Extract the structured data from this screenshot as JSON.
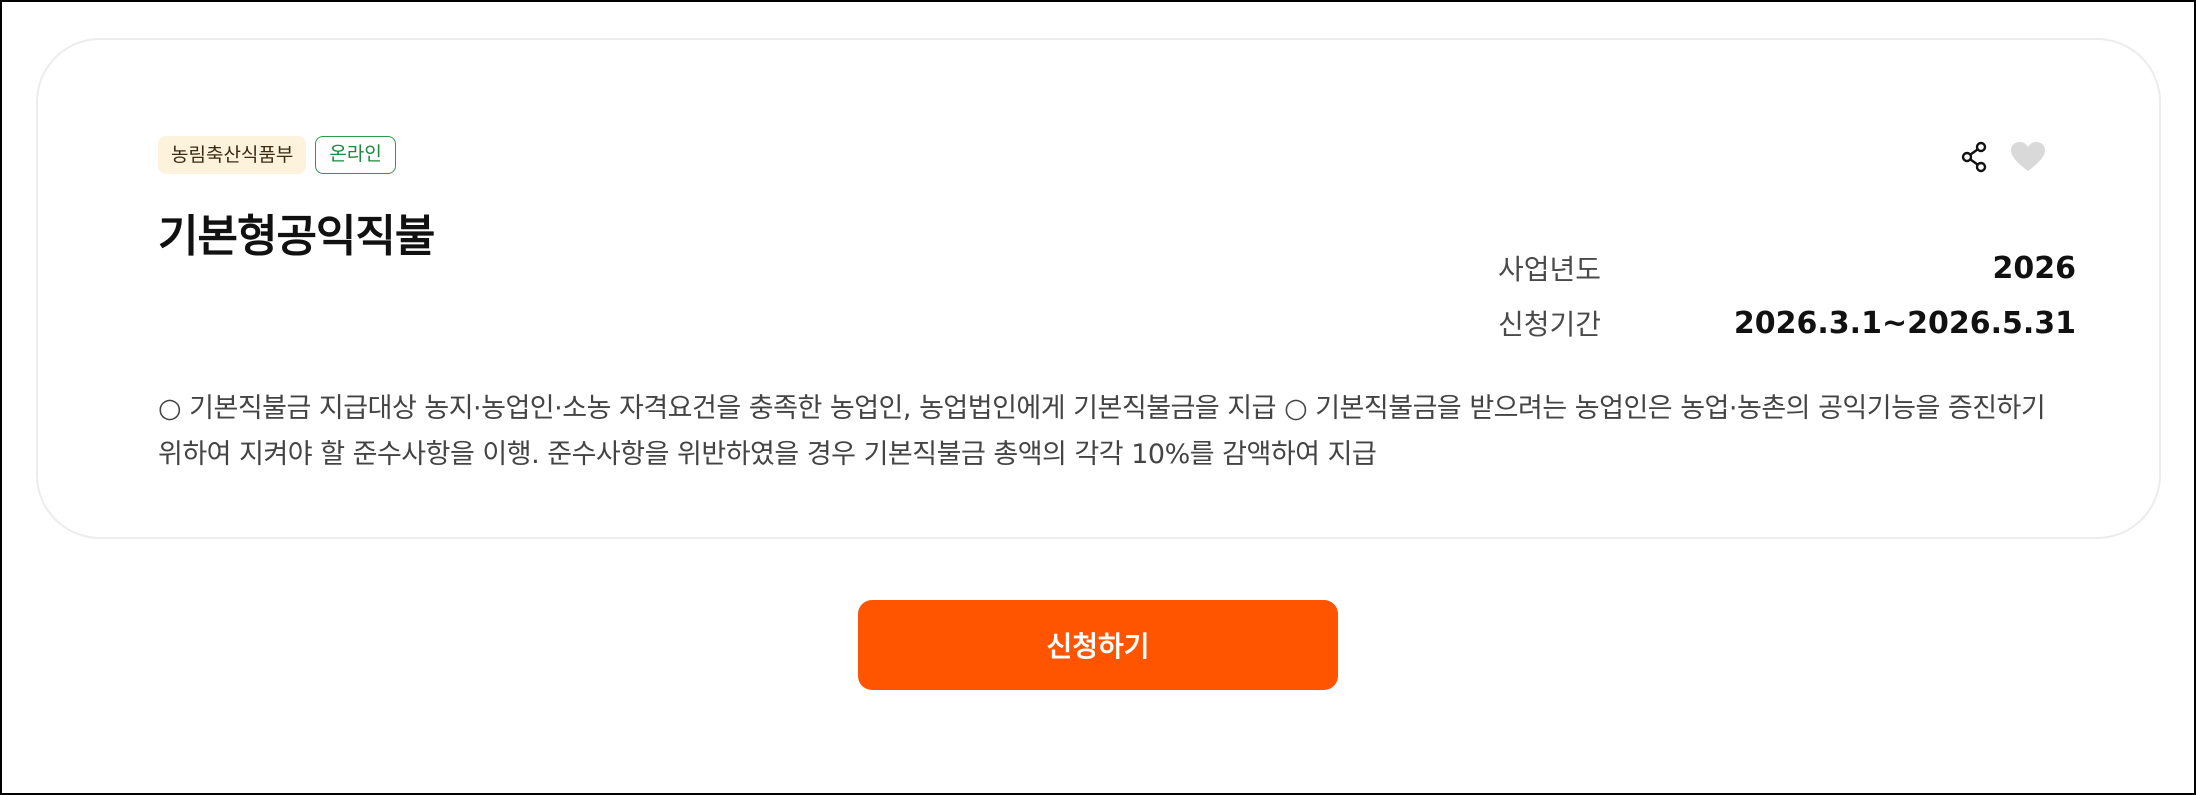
{
  "card": {
    "tags": {
      "ministry": "농림축산식품부",
      "channel": "온라인"
    },
    "title": "기본형공익직불",
    "meta": {
      "year_label": "사업년도",
      "year_value": "2026",
      "period_label": "신청기간",
      "period_value": "2026.3.1~2026.5.31"
    },
    "description": "○ 기본직불금 지급대상 농지·농업인·소농 자격요건을 충족한 농업인, 농업법인에게 기본직불금을 지급 ○ 기본직불금을 받으려는 농업인은 농업·농촌의 공익기능을 증진하기 위하여 지켜야 할 준수사항을 이행. 준수사항을 위반하였을 경우 기본직불금 총액의 각각 10%를 감액하여 지급",
    "icons": {
      "share": "share-icon",
      "like": "heart-icon"
    }
  },
  "apply_button": {
    "label": "신청하기"
  },
  "colors": {
    "accent": "#ff5500",
    "ministry_tag_bg": "#fdf2dc",
    "online_tag": "#2c9b4c",
    "heart": "#d9d9d9"
  }
}
